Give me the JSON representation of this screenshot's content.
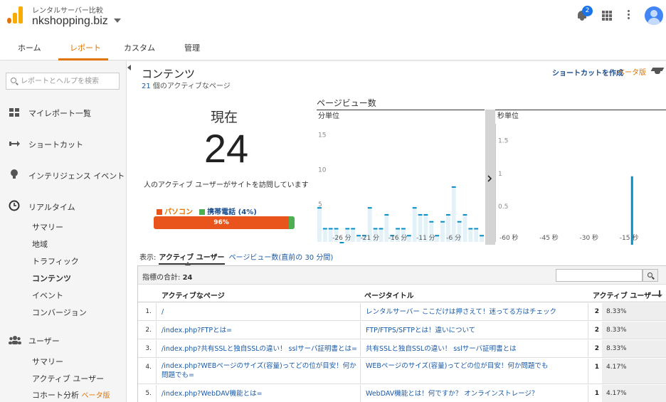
{
  "account": {
    "property_group": "レンタルサーバー比較",
    "property_name": "nkshopping.biz",
    "notification_count": "2"
  },
  "nav": {
    "tabs": [
      {
        "label": "ホーム",
        "active": false
      },
      {
        "label": "レポート",
        "active": true
      },
      {
        "label": "カスタム",
        "active": false
      },
      {
        "label": "管理",
        "active": false
      }
    ]
  },
  "sidebar": {
    "search_placeholder": "レポートとヘルプを検索",
    "items": [
      {
        "label": "マイレポート一覧",
        "icon": "dashboard-grid-icon"
      },
      {
        "label": "ショートカット",
        "icon": "shortcut-arrow-icon"
      },
      {
        "label": "インテリジェンス イベント",
        "icon": "lightbulb-icon"
      },
      {
        "label": "リアルタイム",
        "icon": "clock-icon"
      }
    ],
    "realtime_sub": [
      {
        "label": "サマリー"
      },
      {
        "label": "地域"
      },
      {
        "label": "トラフィック"
      },
      {
        "label": "コンテンツ"
      },
      {
        "label": "イベント"
      },
      {
        "label": "コンバージョン"
      }
    ],
    "users_item": {
      "label": "ユーザー",
      "icon": "users-icon"
    },
    "users_sub": [
      {
        "label": "サマリー"
      },
      {
        "label": "アクティブ ユーザー"
      },
      {
        "label": "コホート分析",
        "beta": "ベータ版"
      }
    ]
  },
  "header": {
    "title": "コンテンツ",
    "active_pages_count": "21",
    "active_pages_suffix": " 個のアクティブなページ",
    "shortcut_label": "ショートカットを作成",
    "shortcut_beta": "ベータ版"
  },
  "now": {
    "label": "現在",
    "value": "24",
    "description": "人のアクティブ ユーザーがサイトを訪問しています",
    "desktop_label": "パソコン",
    "mobile_label": "携帯電話 (4%)",
    "desktop_pct_text": "96%",
    "desktop_pct": 96,
    "mobile_pct": 4,
    "colors": {
      "desktop": "#e8541b",
      "mobile": "#4caf50"
    }
  },
  "pageviews": {
    "title": "ページビュー数",
    "minute_label": "分単位",
    "second_label": "秒単位"
  },
  "chart_data": [
    {
      "type": "bar",
      "title": "分単位",
      "ylim": [
        0,
        17
      ],
      "yticks": [
        "15",
        "10",
        "5"
      ],
      "ytick_values": [
        15,
        10,
        5
      ],
      "xticks": [
        "-26 分",
        "-21 分",
        "-16 分",
        "-11 分",
        "-6 分"
      ],
      "xtick_positions": [
        -26,
        -21,
        -16,
        -11,
        -6
      ],
      "x": [
        -30,
        -29,
        -28,
        -27,
        -26,
        -25,
        -24,
        -23,
        -22,
        -21,
        -20,
        -19,
        -18,
        -17,
        -16,
        -15,
        -14,
        -13,
        -12,
        -11,
        -10,
        -9,
        -8,
        -7,
        -6,
        -5,
        -4,
        -3,
        -2,
        -1
      ],
      "values": [
        5,
        2,
        2,
        2,
        0,
        2,
        2,
        1,
        1,
        5,
        2,
        2,
        4,
        1,
        2,
        2,
        1,
        5,
        4,
        4,
        3,
        1,
        3,
        4,
        8,
        3,
        4,
        2,
        2,
        1
      ],
      "color": "#058dc7"
    },
    {
      "type": "bar",
      "title": "秒単位",
      "ylim": [
        0,
        1.8
      ],
      "yticks": [
        "1.5",
        "1",
        "0.5"
      ],
      "ytick_values": [
        1.5,
        1,
        0.5
      ],
      "xticks": [
        "-60 秒",
        "-45 秒",
        "-30 秒",
        "-15 秒"
      ],
      "xtick_positions": [
        -60,
        -45,
        -30,
        -15
      ],
      "x": [
        -14
      ],
      "values": [
        1
      ],
      "color": "#058dc7"
    }
  ],
  "show": {
    "label": "表示:",
    "active": "アクティブ ユーザー",
    "alt": "ページビュー数(直前の 30 分間)"
  },
  "table": {
    "totals_label": "指標の合計: ",
    "totals_value": "24",
    "columns": {
      "page": "アクティブなページ",
      "title": "ページタイトル",
      "users": "アクティブ ユーザー"
    },
    "rows": [
      {
        "num": "1.",
        "page": "/",
        "title": "レンタルサーバー ここだけは押さえて！迷ってる方はチェック",
        "count": "2",
        "pct": "8.33%"
      },
      {
        "num": "2.",
        "page": "/index.php?FTPとは=",
        "title": "FTP/FTPS/SFTPとは！違いについて",
        "count": "2",
        "pct": "8.33%"
      },
      {
        "num": "3.",
        "page": "/index.php?共有SSLと独自SSLの違い！ sslサーバ証明書とは=",
        "title": "共有SSLと独自SSLの違い！ sslサーバ証明書とは",
        "count": "2",
        "pct": "8.33%"
      },
      {
        "num": "4.",
        "page": "/index.php?WEBページのサイズ(容量)ってどの位が目安！何か問題でも=",
        "title": "WEBページのサイズ(容量)ってどの位が目安！何か問題でも",
        "count": "1",
        "pct": "4.17%"
      },
      {
        "num": "5.",
        "page": "/index.php?WebDAV機能とは=",
        "title": "WebDAV機能とは！何ですか？ オンラインストレージ？",
        "count": "1",
        "pct": "4.17%"
      }
    ]
  }
}
